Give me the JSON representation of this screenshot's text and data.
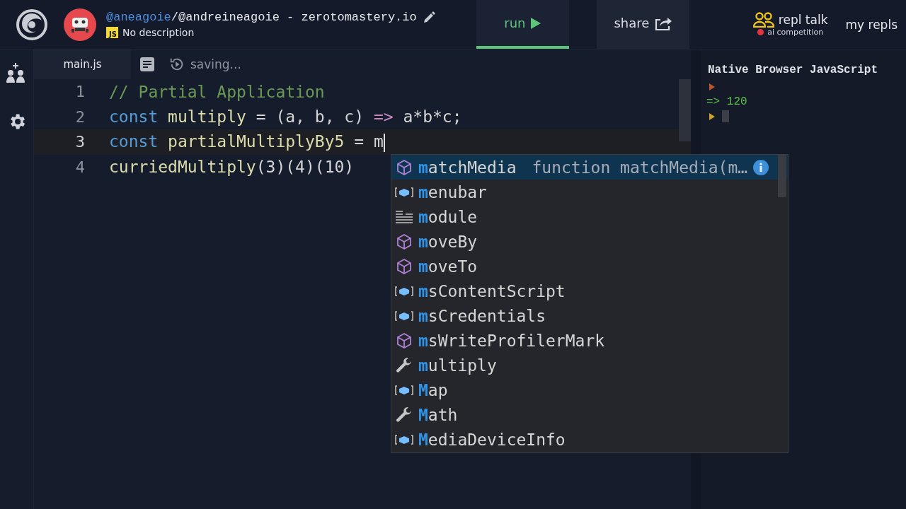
{
  "header": {
    "owner": "@aneagoie",
    "title": "/@andreineagoie - zerotomastery.io",
    "language_badge": "JS",
    "description": "No description",
    "actions": [
      {
        "kind": "run",
        "label": "run",
        "selected": true
      },
      {
        "kind": "share",
        "label": "share",
        "selected": false
      }
    ],
    "talk": {
      "label": "repl talk",
      "sub": "ai competition"
    },
    "my_repls": "my repls"
  },
  "tabs": [
    {
      "kind": "file",
      "label": "main.js",
      "selected": true
    },
    {
      "kind": "files",
      "selected": false
    },
    {
      "kind": "status",
      "label": "saving...",
      "selected": false
    }
  ],
  "editor": {
    "lines": [
      {
        "number": "1",
        "active": false,
        "cursor": false,
        "tokens": [
          {
            "kind": "comment",
            "text": "// Partial Application"
          }
        ]
      },
      {
        "number": "2",
        "active": false,
        "cursor": false,
        "tokens": [
          {
            "kind": "keyword",
            "text": "const "
          },
          {
            "kind": "ident",
            "text": "multiply"
          },
          {
            "kind": "plain",
            "text": " = (a, b, c) "
          },
          {
            "kind": "arrow",
            "text": "=>"
          },
          {
            "kind": "plain",
            "text": " a*b*c;"
          }
        ]
      },
      {
        "number": "3",
        "active": true,
        "cursor": true,
        "tokens": [
          {
            "kind": "keyword",
            "text": "const "
          },
          {
            "kind": "ident",
            "text": "partialMultiplyBy5"
          },
          {
            "kind": "plain",
            "text": " = m"
          }
        ]
      },
      {
        "number": "4",
        "active": false,
        "cursor": false,
        "tokens": [
          {
            "kind": "ident",
            "text": "curriedMultiply"
          },
          {
            "kind": "plain",
            "text": "(3)(4)(10)"
          }
        ]
      }
    ]
  },
  "suggestions": [
    {
      "kind": "method",
      "match": "m",
      "rest": "atchMedia",
      "selected": true,
      "detail": "function matchMedia(m…"
    },
    {
      "kind": "field",
      "match": "m",
      "rest": "enubar",
      "selected": false
    },
    {
      "kind": "module",
      "match": "m",
      "rest": "odule",
      "selected": false
    },
    {
      "kind": "method",
      "match": "m",
      "rest": "oveBy",
      "selected": false
    },
    {
      "kind": "method",
      "match": "m",
      "rest": "oveTo",
      "selected": false
    },
    {
      "kind": "field",
      "match": "m",
      "rest": "sContentScript",
      "selected": false
    },
    {
      "kind": "field",
      "match": "m",
      "rest": "sCredentials",
      "selected": false
    },
    {
      "kind": "method",
      "match": "m",
      "rest": "sWriteProfilerMark",
      "selected": false
    },
    {
      "kind": "variable",
      "match": "m",
      "rest": "ultiply",
      "selected": false
    },
    {
      "kind": "field",
      "match": "M",
      "rest": "ap",
      "selected": false
    },
    {
      "kind": "variable",
      "match": "M",
      "rest": "ath",
      "selected": false
    },
    {
      "kind": "field",
      "match": "M",
      "rest": "ediaDeviceInfo",
      "selected": false
    }
  ],
  "console": {
    "title": "Native Browser JavaScript",
    "lines": [
      {
        "kind": "prompt",
        "color": "#c0552f"
      },
      {
        "kind": "result",
        "arrow": "=>",
        "text": "120"
      },
      {
        "kind": "input",
        "color": "#c9a227"
      }
    ]
  }
}
